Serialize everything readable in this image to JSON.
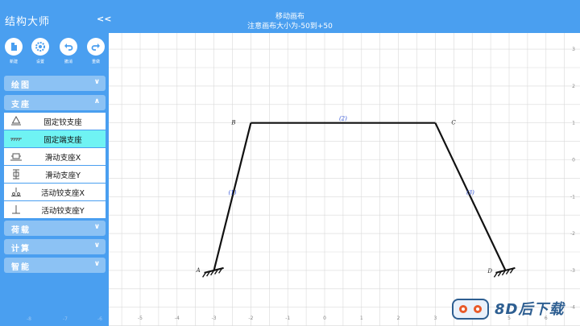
{
  "app": {
    "title": "结构大师",
    "collapse_label": "<<"
  },
  "header": {
    "title": "移动画布",
    "hint": "注意画布大小为-50到+50"
  },
  "toolbar": [
    {
      "label": "新建",
      "icon": "file-icon"
    },
    {
      "label": "设置",
      "icon": "gear-icon"
    },
    {
      "label": "撤消",
      "icon": "undo-icon"
    },
    {
      "label": "重做",
      "icon": "redo-icon"
    }
  ],
  "groups": {
    "draw": {
      "label": "绘图",
      "chevron": "∨"
    },
    "support": {
      "label": "支座",
      "chevron": "∧"
    },
    "load": {
      "label": "荷载",
      "chevron": "∨"
    },
    "calc": {
      "label": "计算",
      "chevron": "∨"
    },
    "smart": {
      "label": "智能",
      "chevron": "∨"
    }
  },
  "support_items": [
    {
      "label": "固定铰支座",
      "icon": "pinned-support-icon",
      "active": false
    },
    {
      "label": "固定端支座",
      "icon": "fixed-support-icon",
      "active": true
    },
    {
      "label": "滑动支座X",
      "icon": "sliding-x-support-icon",
      "active": false
    },
    {
      "label": "滑动支座Y",
      "icon": "sliding-y-support-icon",
      "active": false
    },
    {
      "label": "活动铰支座X",
      "icon": "roller-x-support-icon",
      "active": false
    },
    {
      "label": "活动铰支座Y",
      "icon": "roller-y-support-icon",
      "active": false
    }
  ],
  "sidebar_ticks": [
    "-8",
    "-7",
    "-6"
  ],
  "canvas": {
    "x_ticks": [
      "-5",
      "-4",
      "-3",
      "-2",
      "-1",
      "0",
      "1",
      "2",
      "3",
      "4",
      "5",
      "6"
    ],
    "y_ticks": [
      "3",
      "2",
      "1",
      "0",
      "-1",
      "-2",
      "-3",
      "-4"
    ],
    "nodes": [
      {
        "label": "A",
        "x": -3,
        "y": -3
      },
      {
        "label": "B",
        "x": -2,
        "y": 1
      },
      {
        "label": "C",
        "x": 3,
        "y": 1
      },
      {
        "label": "D",
        "x": 4.9,
        "y": -3
      }
    ],
    "members": [
      {
        "label": "(1)",
        "from": 0,
        "to": 1
      },
      {
        "label": "(2)",
        "from": 1,
        "to": 2
      },
      {
        "label": "(3)",
        "from": 2,
        "to": 3
      }
    ],
    "supports": [
      {
        "type": "fixed",
        "node": 0
      },
      {
        "type": "fixed",
        "node": 3
      }
    ],
    "colors": {
      "grid": "#d9d9d9",
      "member": "#111111",
      "member_label": "#2c4fd6",
      "tick": "#888888"
    }
  },
  "watermark": {
    "text": "8D后下载"
  },
  "colors": {
    "primary": "#4a9ff0",
    "group_header": "#8cc2f4",
    "active_item": "#6ff3f3"
  }
}
